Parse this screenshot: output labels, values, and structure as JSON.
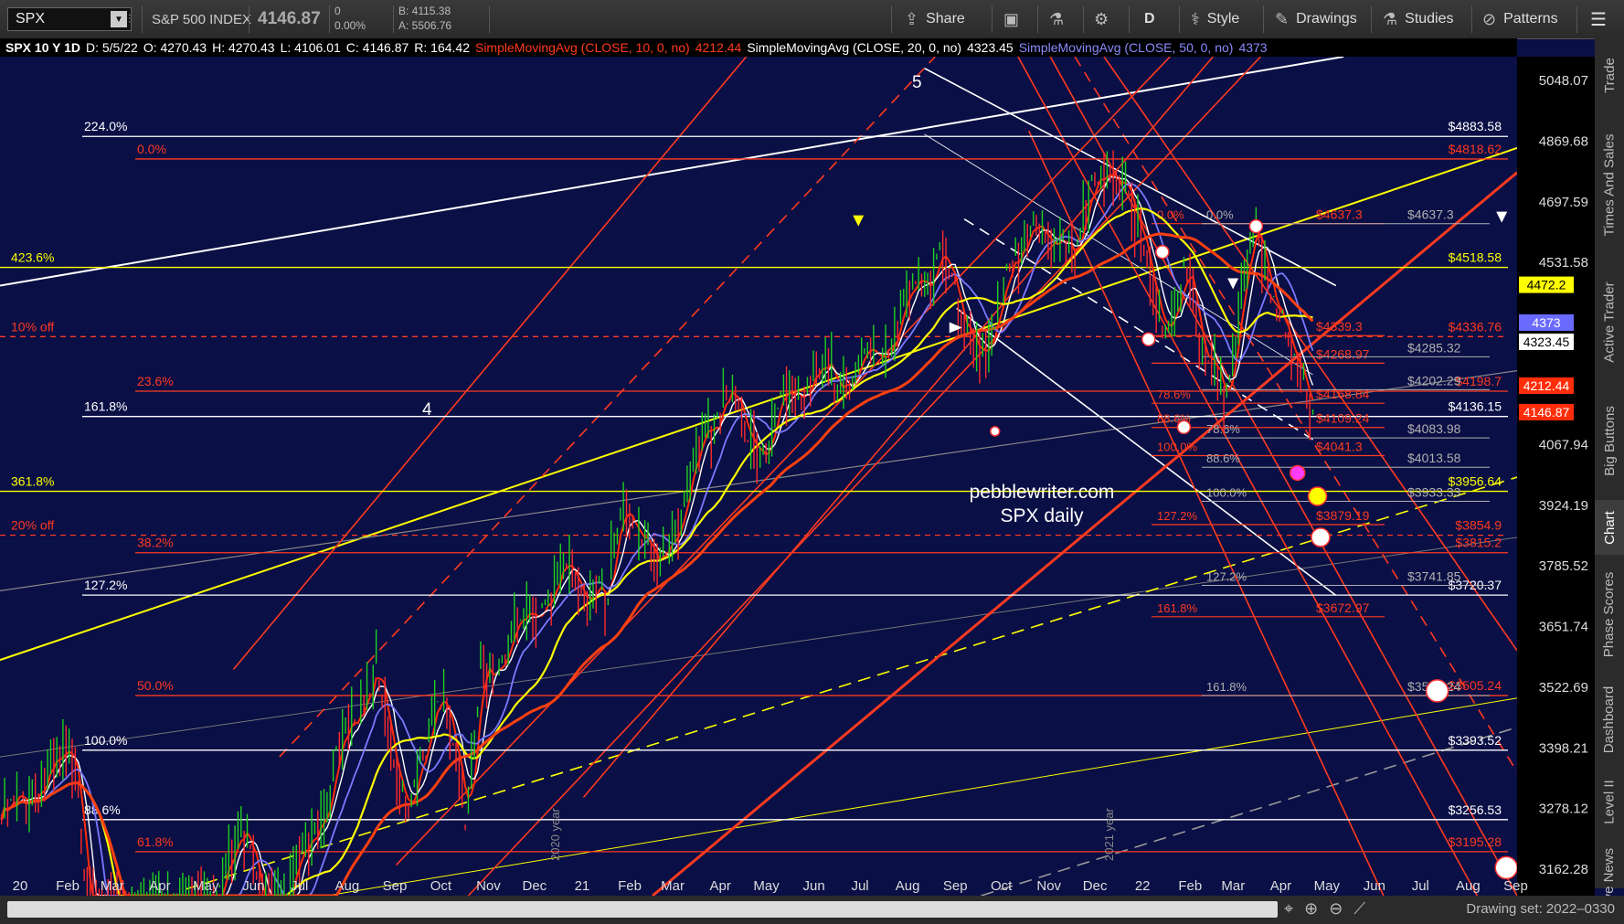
{
  "toolbar": {
    "symbol": "SPX",
    "index_name": "S&P 500 INDEX",
    "last_price": "4146.87",
    "change": "0",
    "change_pct": "0.00%",
    "bid": "B: 4115.38",
    "ask": "A: 5506.76",
    "buttons": {
      "share": "Share",
      "period": "D",
      "style": "Style",
      "drawings": "Drawings",
      "studies": "Studies",
      "patterns": "Patterns"
    }
  },
  "infobar": {
    "chart_label": "SPX 10 Y 1D",
    "date": "D: 5/5/22",
    "open": "O: 4270.43",
    "high": "H: 4270.43",
    "low": "L: 4106.01",
    "close": "C: 4146.87",
    "range": "R: 164.42",
    "sma10": "SimpleMovingAvg (CLOSE, 10, 0, no)",
    "sma10_val": "4212.44",
    "sma20": "SimpleMovingAvg (CLOSE, 20, 0, no)",
    "sma20_val": "4323.45",
    "sma50": "SimpleMovingAvg (CLOSE, 50, 0, no)",
    "sma50_val": "4373"
  },
  "right_tabs": [
    "Trade",
    "Times And Sales",
    "Active Trader",
    "Big Buttons",
    "Chart",
    "Phase Scores",
    "Dashboard",
    "Level II",
    "Live News"
  ],
  "bottom": {
    "drawing_set": "Drawing set: 2022–0330"
  },
  "watermark": {
    "line1": "pebblewriter.com",
    "line2": "SPX daily"
  },
  "wave_labels": [
    "5",
    "4"
  ],
  "year_labels": [
    "2020 year",
    "2021 year"
  ],
  "colors": {
    "background": "#0a0f45",
    "sma10": "#ff2d0a",
    "sma20": "#ffffff",
    "sma50": "#7a7aff",
    "sma100": "#ffff00",
    "sma200": "#ff4010",
    "fib_red": "#ff3a20",
    "fib_white": "#ffffff",
    "fib_yellow": "#ffff00",
    "fib_gray": "#b0b0b0"
  },
  "chart_data": {
    "type": "line",
    "title": "SPX 10 Y 1D",
    "ylim": [
      3113,
      5120
    ],
    "xlim": [
      "2020-01-01",
      "2022-09-15"
    ],
    "scale": "log",
    "y_ticks": [
      "5048.07",
      "4869.68",
      "4697.59",
      "4531.58",
      "4067.94",
      "3924.19",
      "3785.52",
      "3651.74",
      "3522.69",
      "3398.21",
      "3278.12",
      "3162.28"
    ],
    "x_ticks": [
      "20",
      "Feb",
      "Mar",
      "Apr",
      "May",
      "Jun",
      "Jul",
      "Aug",
      "Sep",
      "Oct",
      "Nov",
      "Dec",
      "21",
      "Feb",
      "Mar",
      "Apr",
      "May",
      "Jun",
      "Jul",
      "Aug",
      "Sep",
      "Oct",
      "Nov",
      "Dec",
      "22",
      "Feb",
      "Mar",
      "Apr",
      "May",
      "Jun",
      "Jul",
      "Aug",
      "Sep"
    ],
    "price_tags": [
      {
        "value": 4472.2,
        "label": "4472.2",
        "bg": "#ffff00",
        "fg": "#000000"
      },
      {
        "value": 4373,
        "label": "4373",
        "bg": "#6a6aff",
        "fg": "#ffffff"
      },
      {
        "value": 4323.45,
        "label": "4323.45",
        "bg": "#ffffff",
        "fg": "#000000"
      },
      {
        "value": 4212.44,
        "label": "4212.44",
        "bg": "#ff2d0a",
        "fg": "#ffffff"
      },
      {
        "value": 4146.87,
        "label": "4146.87",
        "bg": "#ff2d0a",
        "fg": "#ffffff"
      }
    ],
    "price_series": {
      "dates": [
        "2020-01-02",
        "2020-02-19",
        "2020-03-23",
        "2020-04-29",
        "2020-06-08",
        "2020-06-26",
        "2020-09-02",
        "2020-09-23",
        "2020-10-12",
        "2020-10-30",
        "2020-11-09",
        "2020-12-31",
        "2021-01-29",
        "2021-02-12",
        "2021-03-04",
        "2021-04-16",
        "2021-05-12",
        "2021-05-31",
        "2021-07-19",
        "2021-09-02",
        "2021-10-04",
        "2021-11-04",
        "2021-12-01",
        "2021-12-10",
        "2022-01-03",
        "2022-01-27",
        "2022-02-10",
        "2022-02-24",
        "2022-03-08",
        "2022-03-29",
        "2022-04-21",
        "2022-05-05"
      ],
      "close": [
        3257,
        3386,
        2237,
        2939,
        3232,
        3009,
        3580,
        3237,
        3534,
        3270,
        3550,
        3756,
        3714,
        3934,
        3768,
        4185,
        4063,
        4204,
        4258,
        4537,
        4300,
        4680,
        4513,
        4712,
        4796,
        4326,
        4504,
        4288,
        4170,
        4631,
        4272,
        4147
      ]
    },
    "fib_levels": [
      {
        "label": "224.0%",
        "value": 4883.58,
        "price_label": "$4883.58",
        "color": "#ffffff"
      },
      {
        "label": "0.0%",
        "value": 4818.62,
        "price_label": "$4818.62",
        "color": "#ff3a20"
      },
      {
        "label": "423.6%",
        "value": 4518.58,
        "price_label": "$4518.58",
        "color": "#ffff00"
      },
      {
        "label": "10% off",
        "value": 4336.76,
        "price_label": "$4336.76",
        "color": "#ff3a20",
        "dashed": true
      },
      {
        "label": "23.6%",
        "value": 4198.7,
        "price_label": "$4198.7",
        "color": "#ff3a20"
      },
      {
        "label": "161.8%",
        "value": 4136.15,
        "price_label": "$4136.15",
        "color": "#ffffff"
      },
      {
        "label": "361.8%",
        "value": 3956.64,
        "price_label": "$3956.64",
        "color": "#ffff00"
      },
      {
        "label": "20% off",
        "value": 3854.9,
        "price_label": "$3854.9",
        "color": "#ff3a20",
        "dashed": true
      },
      {
        "label": "38.2%",
        "value": 3815.2,
        "price_label": "$3815.2",
        "color": "#ff3a20"
      },
      {
        "label": "127.2%",
        "value": 3720.37,
        "price_label": "$3720.37",
        "color": "#ffffff"
      },
      {
        "label": "50.0%",
        "value": 3505.24,
        "price_label": "$3505.24",
        "color": "#ff3a20"
      },
      {
        "label": "100.0%",
        "value": 3393.52,
        "price_label": "$3393.52",
        "color": "#ffffff"
      },
      {
        "label": "88.6%",
        "value": 3256.53,
        "price_label": "$3256.53",
        "color": "#ffffff"
      },
      {
        "label": "61.8%",
        "value": 3195.28,
        "price_label": "$3195.28",
        "color": "#ff3a20"
      }
    ],
    "fib_right_red": [
      {
        "label": "0.0%",
        "value": 4637.3,
        "price_label": "$4637.3"
      },
      {
        "label": "",
        "value": 4339.3,
        "price_label": "$4339.3"
      },
      {
        "label": "",
        "value": 4268.97,
        "price_label": "$4268.97"
      },
      {
        "label": "78.6%",
        "value": 4168.84,
        "price_label": "$4168.84"
      },
      {
        "label": "88.6%",
        "value": 4109.24,
        "price_label": "$4109.24"
      },
      {
        "label": "100.0%",
        "value": 4041.3,
        "price_label": "$4041.3"
      },
      {
        "label": "127.2%",
        "value": 3879.19,
        "price_label": "$3879.19"
      },
      {
        "label": "161.8%",
        "value": 3672.97,
        "price_label": "$3672.97"
      }
    ],
    "fib_right_gray": [
      {
        "label": "0.0%",
        "value": 4637.3,
        "price_label": "$4637.3"
      },
      {
        "label": "",
        "value": 4285.32,
        "price_label": "$4285.32"
      },
      {
        "label": "",
        "value": 4202.29,
        "price_label": "$4202.29"
      },
      {
        "label": "78.6%",
        "value": 4083.98,
        "price_label": "$4083.98"
      },
      {
        "label": "88.6%",
        "value": 4013.58,
        "price_label": "$4013.58"
      },
      {
        "label": "100.0%",
        "value": 3933.33,
        "price_label": "$3933.33"
      },
      {
        "label": "127.2%",
        "value": 3741.85,
        "price_label": "$3741.85"
      },
      {
        "label": "161.8%",
        "value": 3505.24,
        "price_label": "$3505.24"
      }
    ]
  }
}
